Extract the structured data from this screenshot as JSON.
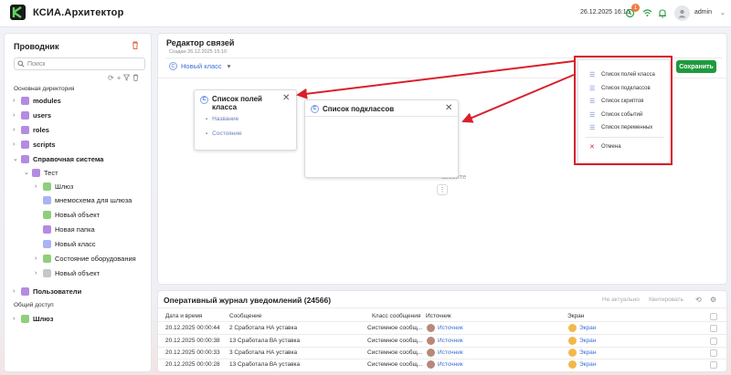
{
  "header": {
    "app_title": "КСИА.Архитектор",
    "datetime": "26.12.2025 16:16",
    "notif_count": "1",
    "username": "admin"
  },
  "sidebar": {
    "title": "Проводник",
    "search_placeholder": "Поиск",
    "section_main": "Основная директория",
    "section_shared": "Общий доступ",
    "items": [
      {
        "label": "modules"
      },
      {
        "label": "users"
      },
      {
        "label": "roles"
      },
      {
        "label": "scripts"
      },
      {
        "label": "Справочная система"
      },
      {
        "label": "Тест"
      },
      {
        "label": "Шлюз"
      },
      {
        "label": "мнемосхема для шлюза"
      },
      {
        "label": "Новый объект"
      },
      {
        "label": "Новая папка"
      },
      {
        "label": "Новый класс"
      },
      {
        "label": "Состояние оборудования"
      },
      {
        "label": "Новый объект"
      },
      {
        "label": "Пользователи"
      },
      {
        "label": "Шлюз"
      }
    ]
  },
  "editor": {
    "title": "Редактор связей",
    "created": "Создан 26.12.2025 15:10",
    "class_name": "Новый класс",
    "save_label": "Сохранить",
    "hint_line1": "о (",
    "hint_line2": "азовите",
    "card_fields": {
      "title": "Список полей класса",
      "items": [
        "Название",
        "Состояние"
      ]
    },
    "card_subclasses": {
      "title": "Список подклассов"
    },
    "menu": {
      "items": [
        "Список полей класса",
        "Список подклассов",
        "Список скриптов",
        "Список событий",
        "Список переменных"
      ],
      "cancel": "Отмена"
    }
  },
  "journal": {
    "title": "Оперативный журнал уведомлений (24566)",
    "not_actual": "Не актуально",
    "acknowledge": "Квитировать",
    "columns": [
      "Дата и время",
      "Сообщение",
      "Класс сообщения",
      "Источник",
      "Экран"
    ],
    "rows": [
      {
        "datetime": "20.12.2025 00:00:44",
        "message": "2 Сработала НА уставка",
        "class": "Системное сообщ...",
        "source": "Источник",
        "screen": "Экран"
      },
      {
        "datetime": "20.12.2025 00:00:38",
        "message": "13 Сработала ВА уставка",
        "class": "Системное сообщ...",
        "source": "Источник",
        "screen": "Экран"
      },
      {
        "datetime": "20.12.2025 00:00:33",
        "message": "3 Сработала НА уставка",
        "class": "Системное сообщ...",
        "source": "Источник",
        "screen": "Экран"
      },
      {
        "datetime": "20.12.2025 00:00:28",
        "message": "13 Сработала ВА уставка",
        "class": "Системное сообщ...",
        "source": "Источник",
        "screen": "Экран"
      }
    ]
  },
  "colors": {
    "accent": "#3a6fd8",
    "save": "#1f9a3e",
    "highlight": "#d9202a",
    "notif_badge": "#f07b3f"
  },
  "icons": [
    "logo-icon",
    "history-icon",
    "wifi-icon",
    "bell-icon",
    "user-icon",
    "trash-icon",
    "search-icon",
    "refresh-icon",
    "plus-icon",
    "filter-icon",
    "delete-icon",
    "list-icon",
    "close-icon",
    "kebab-icon",
    "settings-icon"
  ]
}
